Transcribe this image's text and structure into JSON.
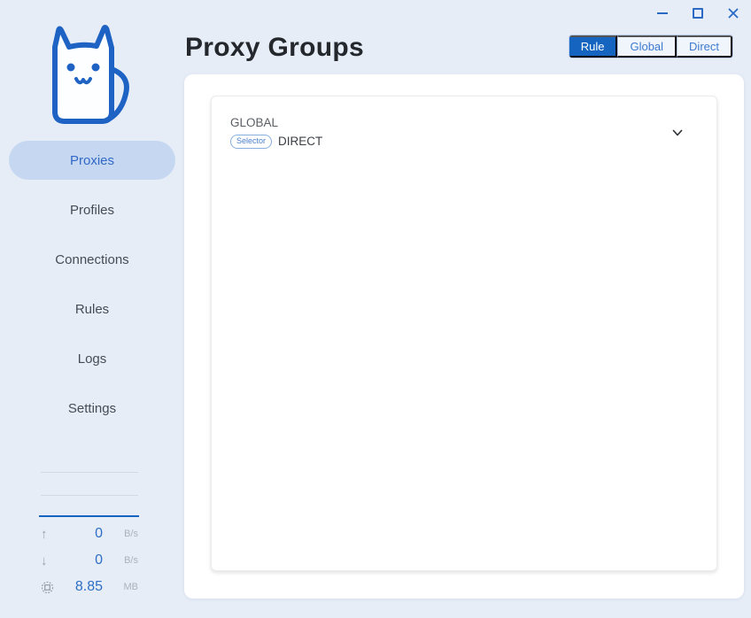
{
  "window": {
    "controls": {
      "minimize": "minimize",
      "maximize": "maximize",
      "close": "close"
    }
  },
  "sidebar": {
    "logo": "clash-cat-logo",
    "nav": [
      {
        "label": "Proxies",
        "active": true
      },
      {
        "label": "Profiles",
        "active": false
      },
      {
        "label": "Connections",
        "active": false
      },
      {
        "label": "Rules",
        "active": false
      },
      {
        "label": "Logs",
        "active": false
      },
      {
        "label": "Settings",
        "active": false
      }
    ],
    "stats": [
      {
        "icon": "arrow-up-icon",
        "glyph": "↑",
        "value": "0",
        "unit": "B/s"
      },
      {
        "icon": "arrow-down-icon",
        "glyph": "↓",
        "value": "0",
        "unit": "B/s"
      },
      {
        "icon": "network-usage-icon",
        "glyph": "dashed-circle-square",
        "value": "8.85",
        "unit": "MB"
      }
    ]
  },
  "header": {
    "title": "Proxy Groups",
    "modes": [
      {
        "label": "Rule",
        "active": true
      },
      {
        "label": "Global",
        "active": false
      },
      {
        "label": "Direct",
        "active": false
      }
    ]
  },
  "groups": [
    {
      "name": "GLOBAL",
      "type_badge": "Selector",
      "selected": "DIRECT"
    }
  ],
  "colors": {
    "accent": "#1565c0",
    "background": "#e6edf7",
    "active_pill": "#c6d8f1",
    "stat_value_blue": "#2e6ec6"
  }
}
